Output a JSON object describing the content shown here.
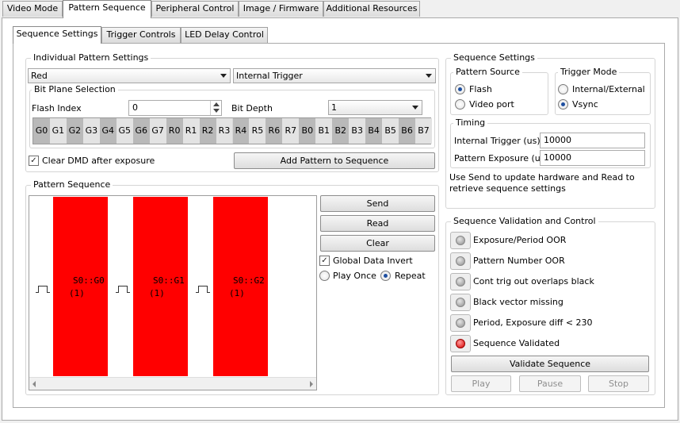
{
  "main_tabs": [
    "Video Mode",
    "Pattern Sequence",
    "Peripheral Control",
    "Image / Firmware",
    "Additional Resources"
  ],
  "sub_tabs": [
    "Sequence Settings",
    "Trigger Controls",
    "LED Delay Control"
  ],
  "individual": {
    "title": "Individual Pattern Settings",
    "color_value": "Red",
    "trigger_value": "Internal Trigger",
    "bitplane_title": "Bit Plane Selection",
    "flash_index_label": "Flash Index",
    "flash_index_value": "0",
    "bit_depth_label": "Bit Depth",
    "bit_depth_value": "1",
    "bit_planes": [
      "G0",
      "G1",
      "G2",
      "G3",
      "G4",
      "G5",
      "G6",
      "G7",
      "R0",
      "R1",
      "R2",
      "R3",
      "R4",
      "R5",
      "R6",
      "R7",
      "B0",
      "B1",
      "B2",
      "B3",
      "B4",
      "B5",
      "B6",
      "B7"
    ],
    "clear_dmd_label": "Clear DMD after exposure",
    "add_button": "Add Pattern to Sequence"
  },
  "pattern_sequence": {
    "title": "Pattern Sequence",
    "patterns": [
      {
        "name": "S0::G0",
        "count": "(1)"
      },
      {
        "name": "S0::G1",
        "count": "(1)"
      },
      {
        "name": "S0::G2",
        "count": "(1)"
      }
    ],
    "send": "Send",
    "read": "Read",
    "clear": "Clear",
    "global_invert": "Global Data Invert",
    "play_once": "Play Once",
    "repeat": "Repeat"
  },
  "sequence_settings": {
    "title": "Sequence Settings",
    "pattern_source_title": "Pattern Source",
    "flash": "Flash",
    "video_port": "Video port",
    "trigger_mode_title": "Trigger Mode",
    "internal_external": "Internal/External",
    "vsync": "Vsync",
    "timing_title": "Timing",
    "internal_trigger_label": "Internal Trigger (us)",
    "internal_trigger_value": "10000",
    "pattern_exposure_label": "Pattern Exposure (us)",
    "pattern_exposure_value": "10000",
    "note": "Use Send to update hardware and Read to retrieve sequence settings"
  },
  "validation": {
    "title": "Sequence Validation and Control",
    "items": [
      {
        "label": "Exposure/Period OOR",
        "state": "gray"
      },
      {
        "label": "Pattern Number OOR",
        "state": "gray"
      },
      {
        "label": "Cont trig out overlaps black",
        "state": "gray"
      },
      {
        "label": "Black vector missing",
        "state": "gray"
      },
      {
        "label": "Period, Exposure diff < 230",
        "state": "gray"
      },
      {
        "label": "Sequence Validated",
        "state": "red"
      }
    ],
    "validate_button": "Validate Sequence",
    "play": "Play",
    "pause": "Pause",
    "stop": "Stop"
  },
  "colors": {
    "pattern_red": "#ff0000",
    "led_red": "#d80000"
  }
}
